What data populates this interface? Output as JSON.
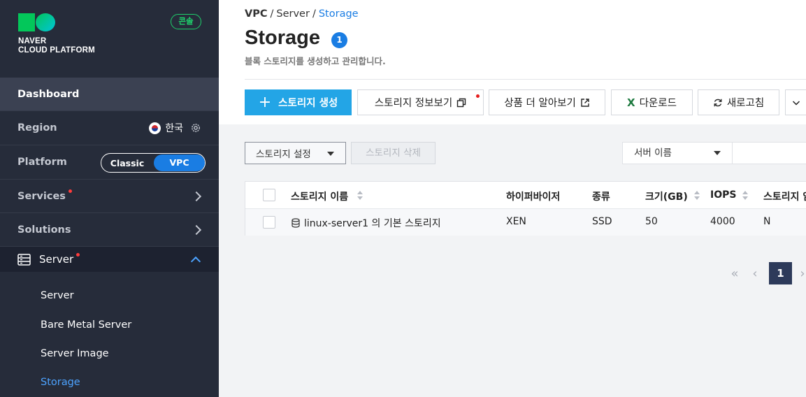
{
  "brand": {
    "line1": "NAVER",
    "line2": "CLOUD PLATFORM",
    "console_badge": "콘솔"
  },
  "sidebar": {
    "dashboard": "Dashboard",
    "region": {
      "label": "Region",
      "value": "한국"
    },
    "platform": {
      "label": "Platform",
      "options": [
        "Classic",
        "VPC"
      ],
      "selected": "VPC"
    },
    "services": "Services",
    "solutions": "Solutions",
    "server_group": "Server",
    "sub_items": [
      "Server",
      "Bare Metal Server",
      "Server Image",
      "Storage"
    ],
    "active_sub_item": "Storage"
  },
  "header": {
    "breadcrumb": [
      "VPC",
      "Server",
      "Storage"
    ],
    "title": "Storage",
    "count": "1",
    "description": "블록 스토리지를 생성하고 관리합니다."
  },
  "toolbar": {
    "create": "스토리지 생성",
    "info": "스토리지 정보보기",
    "learn_more": "상품 더 알아보기",
    "download": "다운로드",
    "refresh": "새로고침"
  },
  "actions": {
    "settings": "스토리지 설정",
    "delete": "스토리지 삭제"
  },
  "filter": {
    "field": "서버 이름",
    "query": ""
  },
  "table": {
    "columns": [
      "스토리지 이름",
      "하이퍼바이저",
      "종류",
      "크기(GB)",
      "IOPS",
      "스토리지 암"
    ],
    "rows": [
      {
        "name": "linux-server1 의 기본 스토리지",
        "hypervisor": "XEN",
        "type": "SSD",
        "size": "50",
        "iops": "4000",
        "encrypted": "N"
      }
    ]
  },
  "pagination": {
    "current": "1"
  },
  "colors": {
    "sidebar_bg": "#262c3a",
    "accent_blue": "#1a7de3",
    "primary_button": "#23a5e6",
    "brand_green": "#03c75a"
  }
}
